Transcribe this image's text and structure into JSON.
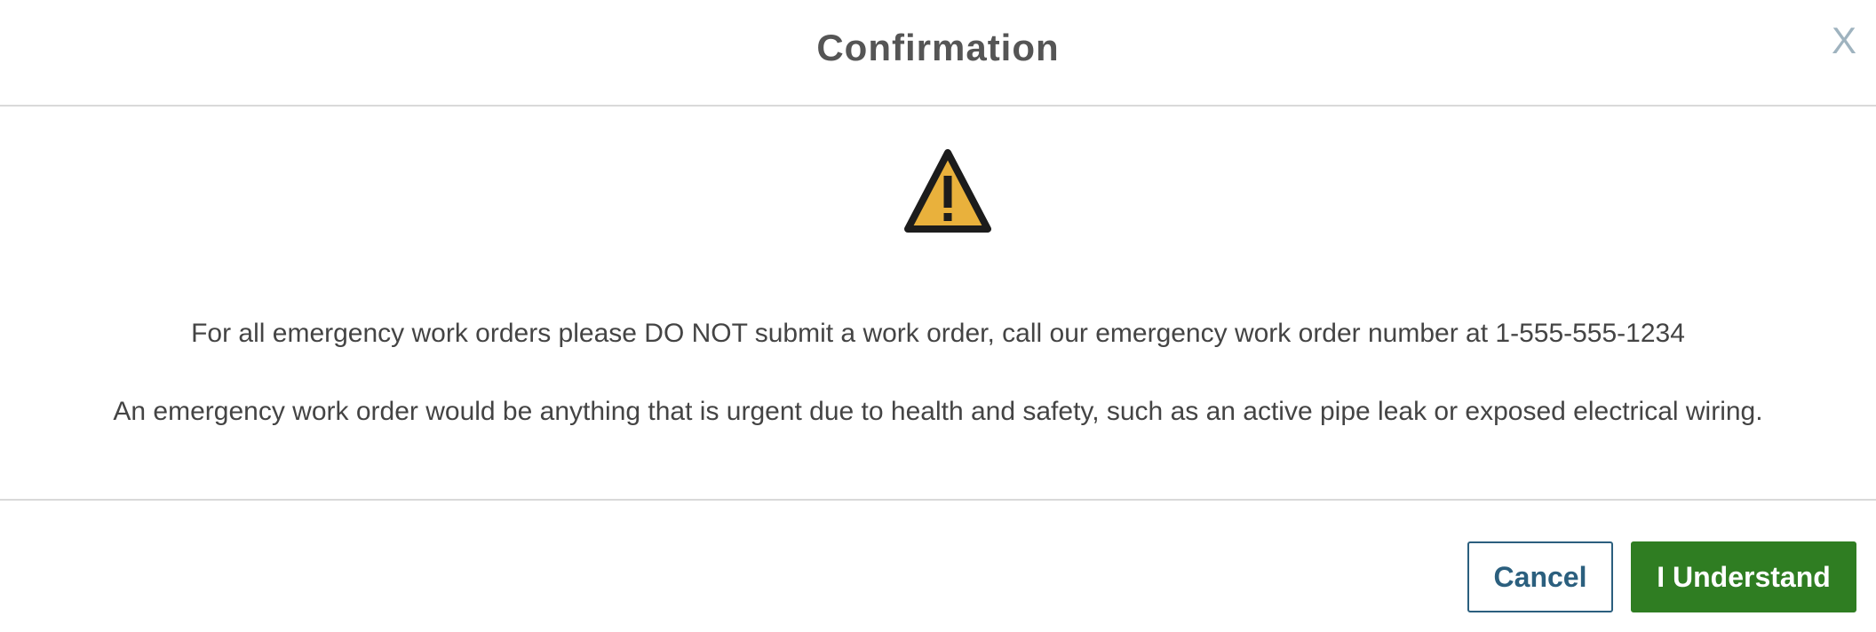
{
  "dialog": {
    "title": "Confirmation",
    "close_label": "X",
    "icon": "warning-triangle-icon",
    "messages": [
      "For all emergency work orders please DO NOT submit a work order, call our emergency work order number at 1-555-555-1234",
      "An emergency work order would be anything that is urgent due to health and safety, such as an active pipe leak or exposed electrical wiring."
    ]
  },
  "buttons": {
    "cancel_label": "Cancel",
    "confirm_label": "I Understand"
  },
  "colors": {
    "title": "#555555",
    "close": "#9fb3bf",
    "warning_fill": "#e9b13c",
    "warning_stroke": "#1c1c1c",
    "cancel_border": "#2b5f7e",
    "confirm_bg": "#2f7d22"
  }
}
